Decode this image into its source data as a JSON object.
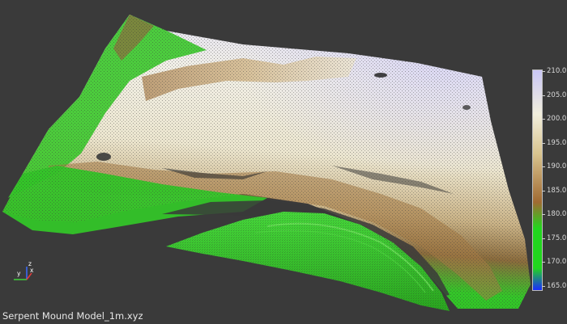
{
  "viewer": {
    "filename": "Serpent Mound Model_1m.xyz",
    "background_color": "#3a3a3a"
  },
  "scalar_bar": {
    "ticks": [
      "210.0",
      "205.0",
      "200.0",
      "195.0",
      "190.0",
      "185.0",
      "180.0",
      "175.0",
      "170.0",
      "165.0"
    ],
    "min": 165.0,
    "max": 210.0,
    "colors": {
      "low": "#1a2cff",
      "green": "#22d61e",
      "brown": "#a06a32",
      "tan": "#d9c48f",
      "cream": "#f2efdd",
      "high": "#c9c6f5"
    }
  },
  "axes_gizmo": {
    "x_label": "x",
    "y_label": "y",
    "z_label": "z"
  }
}
